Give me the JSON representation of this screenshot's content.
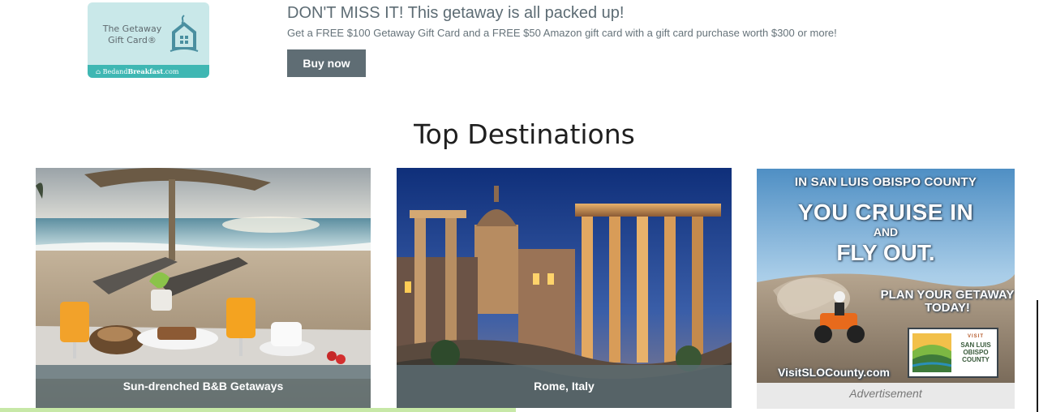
{
  "promo": {
    "gift_card": {
      "line1": "The Getaway",
      "line2": "Gift Card®",
      "brand_prefix": "Bed",
      "brand_mid": "and",
      "brand_bold": "Breakfast",
      "brand_suffix": ".com",
      "icon": "house-gift-icon"
    },
    "headline": "DON'T MISS IT! This getaway is all packed up!",
    "subtext": "Get a FREE $100 Getaway Gift Card and a FREE $50 Amazon gift card with a gift card purchase worth $300 or more!",
    "button_label": "Buy now"
  },
  "section_title": "Top Destinations",
  "destinations": [
    {
      "caption": "Sun-drenched B&B Getaways",
      "image": "beach-breakfast-photo"
    },
    {
      "caption": "Rome, Italy",
      "image": "roman-forum-photo"
    }
  ],
  "advertisement": {
    "line_top": "IN SAN LUIS OBISPO COUNTY",
    "line_cruise": "YOU CRUISE IN",
    "line_and": "AND",
    "line_fly": "FLY OUT.",
    "line_plan": "PLAN YOUR GETAWAY TODAY!",
    "url": "VisitSLOCounty.com",
    "logo_visit": "VISIT",
    "logo_name": "SAN LUIS\nOBISPO\nCOUNTY",
    "label": "Advertisement"
  },
  "colors": {
    "button_bg": "#5f6d74",
    "headline": "#5d6c74",
    "gift_card_bg": "#c9e8e9",
    "gift_card_footer": "#3fb7b3",
    "caption_overlay": "#5c7076"
  }
}
